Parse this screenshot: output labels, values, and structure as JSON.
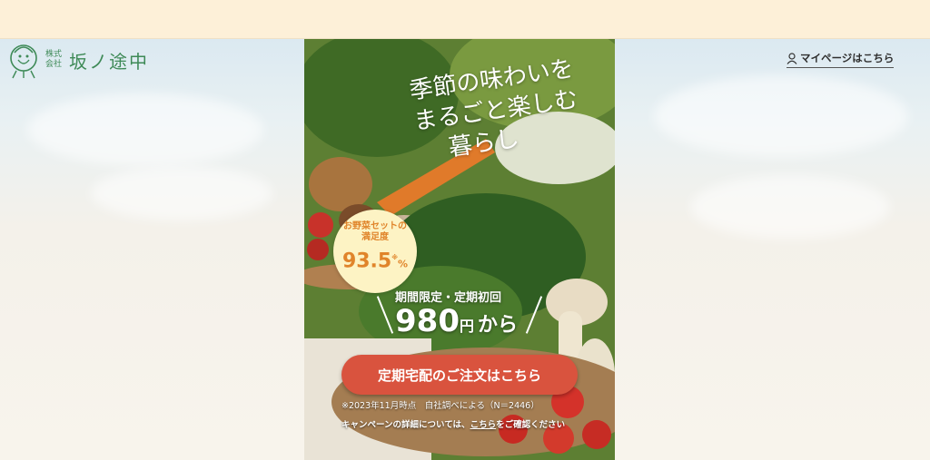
{
  "header": {
    "logo_small": "株式会社",
    "logo_name": "坂ノ途中",
    "mypage_label": "マイページはこちら"
  },
  "hero": {
    "headline_line1": "季節の味わいを",
    "headline_line2": "まるごと楽しむ",
    "headline_line3": "暮らし",
    "badge_line1": "お野菜セットの",
    "badge_line2": "満足度",
    "badge_value": "93.5",
    "badge_mark": "※",
    "badge_unit": "%",
    "period_label": "期間限定・定期初回",
    "price_value": "980",
    "price_unit": "円",
    "price_suffix": "から",
    "cta_label": "定期宅配のご注文はこちら",
    "note": "※2023年11月時点　自社調べによる（N＝2446）",
    "campaign_prefix": "キャンペーンの詳細については、",
    "campaign_link": "こちら",
    "campaign_suffix": "をご確認ください"
  },
  "colors": {
    "topbar": "#fdf0d8",
    "brand_green": "#3e8a57",
    "cta": "#d9533e",
    "badge_bg": "#fdf3c4",
    "badge_text": "#e0842a"
  }
}
